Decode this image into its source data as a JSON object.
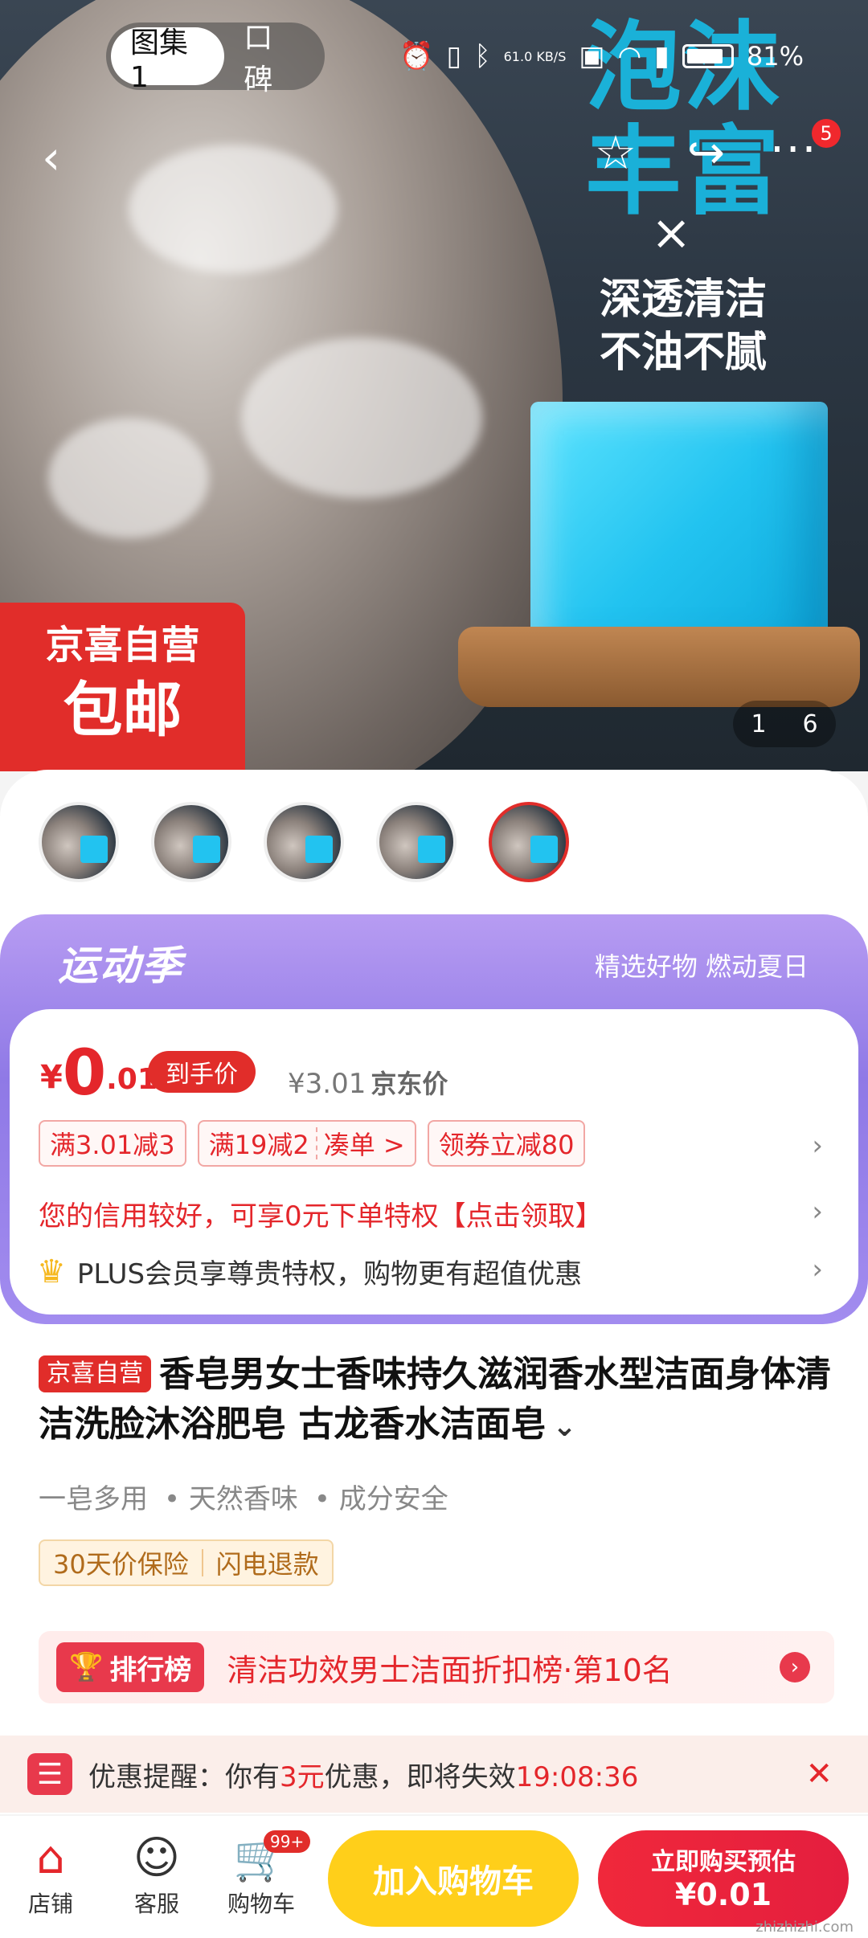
{
  "status_bar": {
    "network_speed": "61.0 KB/S",
    "battery": "81%"
  },
  "tabs": [
    {
      "label": "图集1"
    },
    {
      "label": "口碑"
    }
  ],
  "nav": {
    "message_badge": "5"
  },
  "hero": {
    "headline": "泡沫丰富",
    "times_symbol": "×",
    "subline": "深透清洁不油不腻",
    "badge_line1": "京喜自营",
    "badge_line2": "包邮",
    "counter_current": "1",
    "counter_total": "6"
  },
  "promo": {
    "season_title": "运动季",
    "slogan": "精选好物 燃动夏日",
    "price_symbol": "¥",
    "price_integer": "0",
    "price_decimal": ".01",
    "price_tag": "到手价",
    "jd_price": "¥3.01",
    "jd_price_label": "京东价",
    "coupons": [
      {
        "text": "满3.01减3"
      },
      {
        "text": "满19减2",
        "extra": "凑单 >"
      },
      {
        "text": "领券立减80"
      }
    ],
    "credit_text": "您的信用较好，可享0元下单特权【点击领取】",
    "plus_text": "PLUS会员享尊贵特权，购物更有超值优惠"
  },
  "product": {
    "badge": "京喜自营",
    "title": "香皂男女士香味持久滋润香水型洁面身体清洁洗脸沐浴肥皂 古龙香水洁面皂",
    "features": [
      "一皂多用",
      "• 天然香味",
      "• 成分安全"
    ],
    "guarantees": [
      "30天价保险",
      "闪电退款"
    ],
    "rank_tag": "排行榜",
    "rank_text": "清洁功效男士洁面折扣榜·第10名"
  },
  "reminder": {
    "prefix": "优惠提醒：你有",
    "amount": "3元",
    "middle": "优惠，即将失效",
    "countdown": "19:08:36"
  },
  "bottom_bar": {
    "shop_label": "店铺",
    "service_label": "客服",
    "cart_label": "购物车",
    "cart_badge": "99+",
    "add_to_cart": "加入购物车",
    "buy_now_line1": "立即购买预估",
    "buy_now_line2": "¥0.01"
  },
  "watermark": "zhizhizhi.com"
}
